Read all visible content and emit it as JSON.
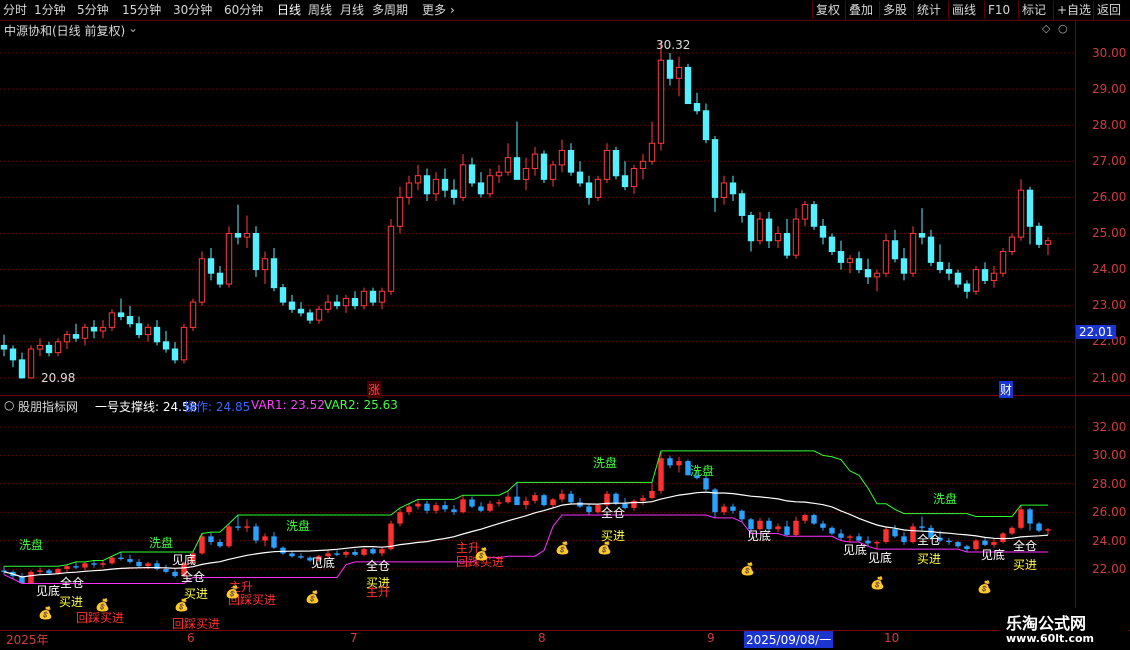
{
  "toolbar": {
    "periods": [
      "分时",
      "1分钟",
      "5分钟",
      "15分钟",
      "30分钟",
      "60分钟",
      "日线",
      "周线",
      "月线",
      "多周期",
      "更多"
    ],
    "more_arrow": "›",
    "right_buttons": [
      "复权",
      "叠加",
      "多股",
      "统计",
      "画线",
      "F10",
      "标记",
      "+自选",
      "返回"
    ]
  },
  "main": {
    "title": "中源协和(日线 前复权)",
    "high_label": "30.32",
    "low_label": "20.98",
    "price_tag": "22.01",
    "badge_zhang": "涨",
    "badge_cai": "财",
    "yticks": [
      "30.00",
      "29.00",
      "28.00",
      "27.00",
      "26.00",
      "25.00",
      "24.00",
      "23.00",
      "22.00",
      "21.00"
    ]
  },
  "indicator": {
    "name": "股朋指标网",
    "l1": "一号支撑线: 24.58",
    "l2": "操作: 24.85",
    "l3": "VAR1: 23.52",
    "l4": "VAR2: 25.63",
    "yticks": [
      "32.00",
      "30.00",
      "28.00",
      "26.00",
      "24.00",
      "22.00"
    ],
    "annotations": {
      "xipan": "洗盘",
      "jiandi": "见底",
      "maijin": "买进",
      "quancang": "全仓",
      "zhusheng": "主升",
      "huicai": "回踩买进"
    }
  },
  "xaxis": {
    "labels": [
      "2025年",
      "6",
      "7",
      "8",
      "9",
      "10"
    ],
    "cursor_date": "2025/09/08/一"
  },
  "watermark": {
    "name": "乐淘公式网",
    "url": "www.60lt.com"
  },
  "colors": {
    "up": "#ff3b3b",
    "down": "#54f0ff",
    "grid": "#7a0000",
    "axis_text": "#d23c3c"
  },
  "chart_data": {
    "type": "candlestick",
    "y_range": [
      20.7,
      30.7
    ],
    "ohlc": [
      [
        21.9,
        22.2,
        21.6,
        21.8
      ],
      [
        21.8,
        21.9,
        21.3,
        21.5
      ],
      [
        21.5,
        21.7,
        20.98,
        21.0
      ],
      [
        21.0,
        21.9,
        20.98,
        21.8
      ],
      [
        21.8,
        22.1,
        21.6,
        21.9
      ],
      [
        21.9,
        22.0,
        21.6,
        21.7
      ],
      [
        21.7,
        22.1,
        21.6,
        22.0
      ],
      [
        22.0,
        22.3,
        21.8,
        22.2
      ],
      [
        22.2,
        22.5,
        22.0,
        22.1
      ],
      [
        22.1,
        22.5,
        21.9,
        22.4
      ],
      [
        22.4,
        22.6,
        22.1,
        22.3
      ],
      [
        22.3,
        22.6,
        22.1,
        22.4
      ],
      [
        22.4,
        22.9,
        22.3,
        22.8
      ],
      [
        22.8,
        23.2,
        22.6,
        22.7
      ],
      [
        22.7,
        23.0,
        22.4,
        22.5
      ],
      [
        22.5,
        22.7,
        22.1,
        22.2
      ],
      [
        22.2,
        22.5,
        22.0,
        22.4
      ],
      [
        22.4,
        22.6,
        21.9,
        22.0
      ],
      [
        22.0,
        22.3,
        21.7,
        21.8
      ],
      [
        21.8,
        22.0,
        21.4,
        21.5
      ],
      [
        21.5,
        22.5,
        21.4,
        22.4
      ],
      [
        22.4,
        23.2,
        22.3,
        23.1
      ],
      [
        23.1,
        24.5,
        23.0,
        24.3
      ],
      [
        24.3,
        24.6,
        23.7,
        23.9
      ],
      [
        23.9,
        24.1,
        23.5,
        23.6
      ],
      [
        23.6,
        25.2,
        23.5,
        25.0
      ],
      [
        25.0,
        25.8,
        24.7,
        24.9
      ],
      [
        24.9,
        25.5,
        24.6,
        25.0
      ],
      [
        25.0,
        25.2,
        23.8,
        24.0
      ],
      [
        24.0,
        24.5,
        23.6,
        24.3
      ],
      [
        24.3,
        24.6,
        23.4,
        23.5
      ],
      [
        23.5,
        23.6,
        23.0,
        23.1
      ],
      [
        23.1,
        23.3,
        22.8,
        22.9
      ],
      [
        22.9,
        23.1,
        22.7,
        22.8
      ],
      [
        22.8,
        22.9,
        22.5,
        22.6
      ],
      [
        22.6,
        23.0,
        22.5,
        22.9
      ],
      [
        22.9,
        23.3,
        22.8,
        23.1
      ],
      [
        23.1,
        23.3,
        22.9,
        23.0
      ],
      [
        23.0,
        23.3,
        22.8,
        23.2
      ],
      [
        23.2,
        23.4,
        22.9,
        23.0
      ],
      [
        23.0,
        23.5,
        22.9,
        23.4
      ],
      [
        23.4,
        23.5,
        23.0,
        23.1
      ],
      [
        23.1,
        23.5,
        22.9,
        23.4
      ],
      [
        23.4,
        25.4,
        23.3,
        25.2
      ],
      [
        25.2,
        26.3,
        25.0,
        26.0
      ],
      [
        26.0,
        26.6,
        25.8,
        26.4
      ],
      [
        26.4,
        26.9,
        26.2,
        26.6
      ],
      [
        26.6,
        26.8,
        25.9,
        26.1
      ],
      [
        26.1,
        26.7,
        25.9,
        26.5
      ],
      [
        26.5,
        26.8,
        26.0,
        26.2
      ],
      [
        26.2,
        26.5,
        25.8,
        26.0
      ],
      [
        26.0,
        27.2,
        25.9,
        26.9
      ],
      [
        26.9,
        27.1,
        26.3,
        26.4
      ],
      [
        26.4,
        26.7,
        26.0,
        26.1
      ],
      [
        26.1,
        26.8,
        26.0,
        26.6
      ],
      [
        26.6,
        26.9,
        26.4,
        26.7
      ],
      [
        26.7,
        27.5,
        26.6,
        27.1
      ],
      [
        27.1,
        28.1,
        26.5,
        26.5
      ],
      [
        26.5,
        27.1,
        26.2,
        26.8
      ],
      [
        26.8,
        27.4,
        26.6,
        27.2
      ],
      [
        27.2,
        27.3,
        26.4,
        26.5
      ],
      [
        26.5,
        27.0,
        26.3,
        26.9
      ],
      [
        26.9,
        27.6,
        26.7,
        27.3
      ],
      [
        27.3,
        27.5,
        26.6,
        26.7
      ],
      [
        26.7,
        27.0,
        26.3,
        26.4
      ],
      [
        26.4,
        26.6,
        25.8,
        26.0
      ],
      [
        26.0,
        26.6,
        25.9,
        26.5
      ],
      [
        26.5,
        27.5,
        26.4,
        27.3
      ],
      [
        27.3,
        27.4,
        26.5,
        26.6
      ],
      [
        26.6,
        27.0,
        26.2,
        26.3
      ],
      [
        26.3,
        26.9,
        26.1,
        26.8
      ],
      [
        26.8,
        27.2,
        26.5,
        27.0
      ],
      [
        27.0,
        28.1,
        26.9,
        27.5
      ],
      [
        27.5,
        30.32,
        27.3,
        29.8
      ],
      [
        29.8,
        30.0,
        29.1,
        29.3
      ],
      [
        29.3,
        29.9,
        28.8,
        29.6
      ],
      [
        29.6,
        29.7,
        28.6,
        28.6
      ],
      [
        28.6,
        28.9,
        28.3,
        28.4
      ],
      [
        28.4,
        28.6,
        27.5,
        27.6
      ],
      [
        27.6,
        27.7,
        25.6,
        26.0
      ],
      [
        26.0,
        26.6,
        25.8,
        26.4
      ],
      [
        26.4,
        26.6,
        25.9,
        26.1
      ],
      [
        26.1,
        26.2,
        25.3,
        25.5
      ],
      [
        25.5,
        25.6,
        24.5,
        24.8
      ],
      [
        24.8,
        25.6,
        24.7,
        25.4
      ],
      [
        25.4,
        25.6,
        24.6,
        24.8
      ],
      [
        24.8,
        25.2,
        24.6,
        25.0
      ],
      [
        25.0,
        25.4,
        24.3,
        24.4
      ],
      [
        24.4,
        25.7,
        24.3,
        25.4
      ],
      [
        25.4,
        25.9,
        25.2,
        25.8
      ],
      [
        25.8,
        25.9,
        25.1,
        25.2
      ],
      [
        25.2,
        25.4,
        24.7,
        24.9
      ],
      [
        24.9,
        25.0,
        24.4,
        24.5
      ],
      [
        24.5,
        24.8,
        24.0,
        24.2
      ],
      [
        24.2,
        24.4,
        23.9,
        24.3
      ],
      [
        24.3,
        24.5,
        23.9,
        24.0
      ],
      [
        24.0,
        24.3,
        23.6,
        23.8
      ],
      [
        23.8,
        24.0,
        23.4,
        23.9
      ],
      [
        23.9,
        25.0,
        23.8,
        24.8
      ],
      [
        24.8,
        25.1,
        24.2,
        24.3
      ],
      [
        24.3,
        24.6,
        23.7,
        23.9
      ],
      [
        23.9,
        25.2,
        23.8,
        25.0
      ],
      [
        25.0,
        25.7,
        24.7,
        24.9
      ],
      [
        24.9,
        25.1,
        24.1,
        24.2
      ],
      [
        24.2,
        24.7,
        23.9,
        24.0
      ],
      [
        24.0,
        24.2,
        23.7,
        23.9
      ],
      [
        23.9,
        24.0,
        23.5,
        23.6
      ],
      [
        23.6,
        23.7,
        23.2,
        23.4
      ],
      [
        23.4,
        24.1,
        23.3,
        24.0
      ],
      [
        24.0,
        24.2,
        23.6,
        23.7
      ],
      [
        23.7,
        24.1,
        23.5,
        23.9
      ],
      [
        23.9,
        24.6,
        23.8,
        24.5
      ],
      [
        24.5,
        25.0,
        24.4,
        24.9
      ],
      [
        24.9,
        26.5,
        24.8,
        26.2
      ],
      [
        26.2,
        26.3,
        24.7,
        25.2
      ],
      [
        25.2,
        25.3,
        24.6,
        24.7
      ],
      [
        24.7,
        24.9,
        24.4,
        24.8
      ]
    ]
  }
}
